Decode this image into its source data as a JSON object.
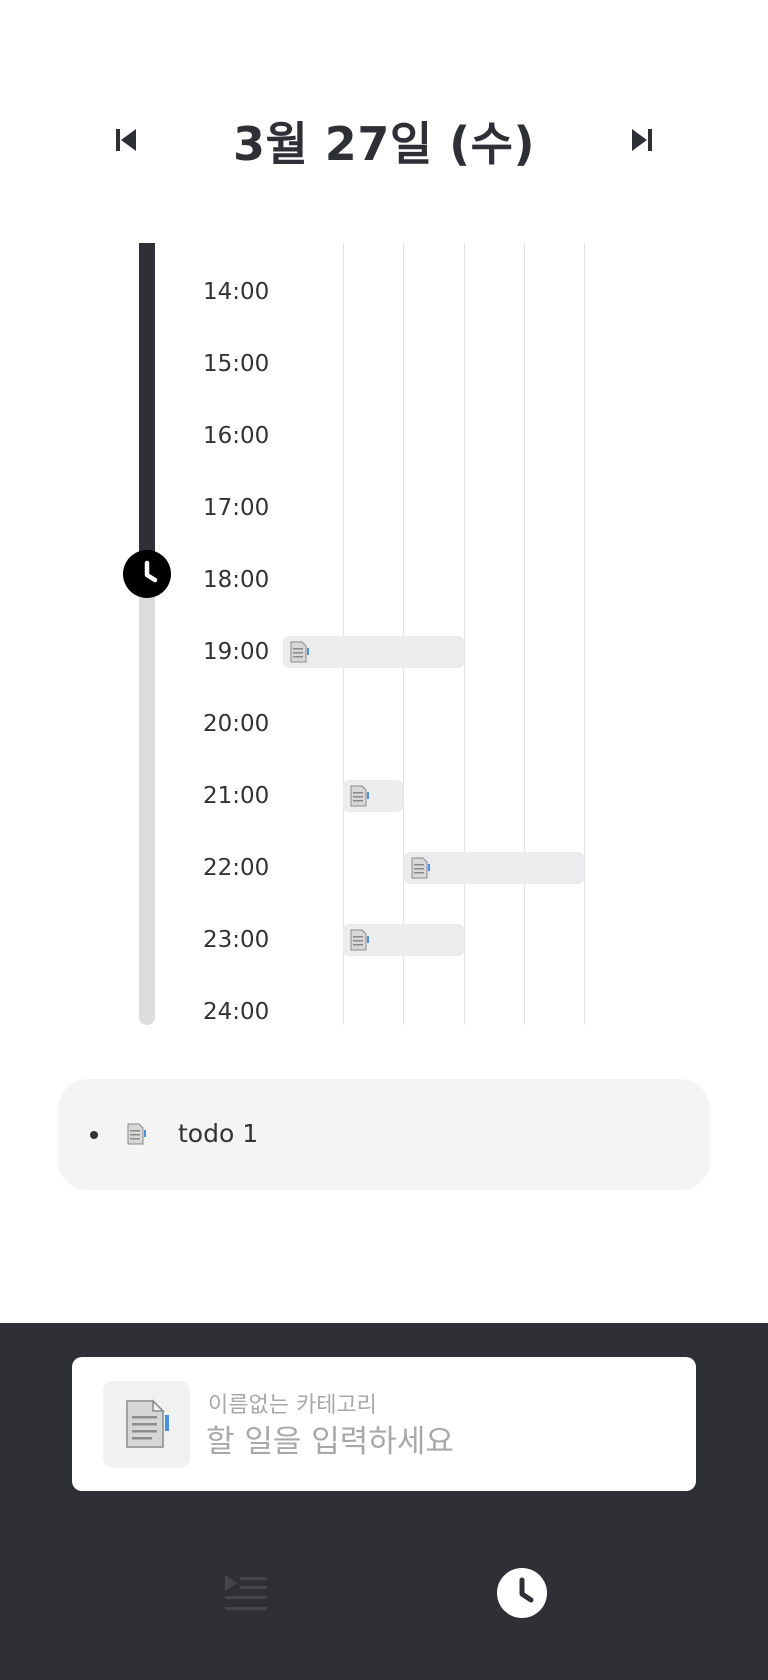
{
  "header": {
    "date_title": "3월 27일 (수)",
    "prev_icon": "skip-previous-icon",
    "next_icon": "skip-next-icon"
  },
  "timeline": {
    "hours": [
      "14:00",
      "15:00",
      "16:00",
      "17:00",
      "18:00",
      "19:00",
      "20:00",
      "21:00",
      "22:00",
      "23:00",
      "24:00"
    ],
    "current_time_icon": "clock-icon",
    "events": [
      {
        "hour": "19:00",
        "icon": "document-icon"
      },
      {
        "hour": "21:00",
        "icon": "document-icon"
      },
      {
        "hour": "22:00",
        "icon": "document-icon"
      },
      {
        "hour": "23:00",
        "icon": "document-icon"
      }
    ]
  },
  "todos": [
    {
      "label": "todo 1",
      "icon": "document-icon"
    }
  ],
  "input_panel": {
    "category_label": "이름없는 카테고리",
    "placeholder": "할 일을 입력하세요",
    "category_icon": "document-icon"
  },
  "bottom_nav": {
    "list_icon": "playlist-icon",
    "timeline_icon": "clock-icon"
  },
  "colors": {
    "dark": "#2f3035",
    "track_light": "#dcdcdc",
    "event_bg": "#ececee",
    "card_bg": "#f4f4f4",
    "muted_text": "#a8a8a8"
  }
}
